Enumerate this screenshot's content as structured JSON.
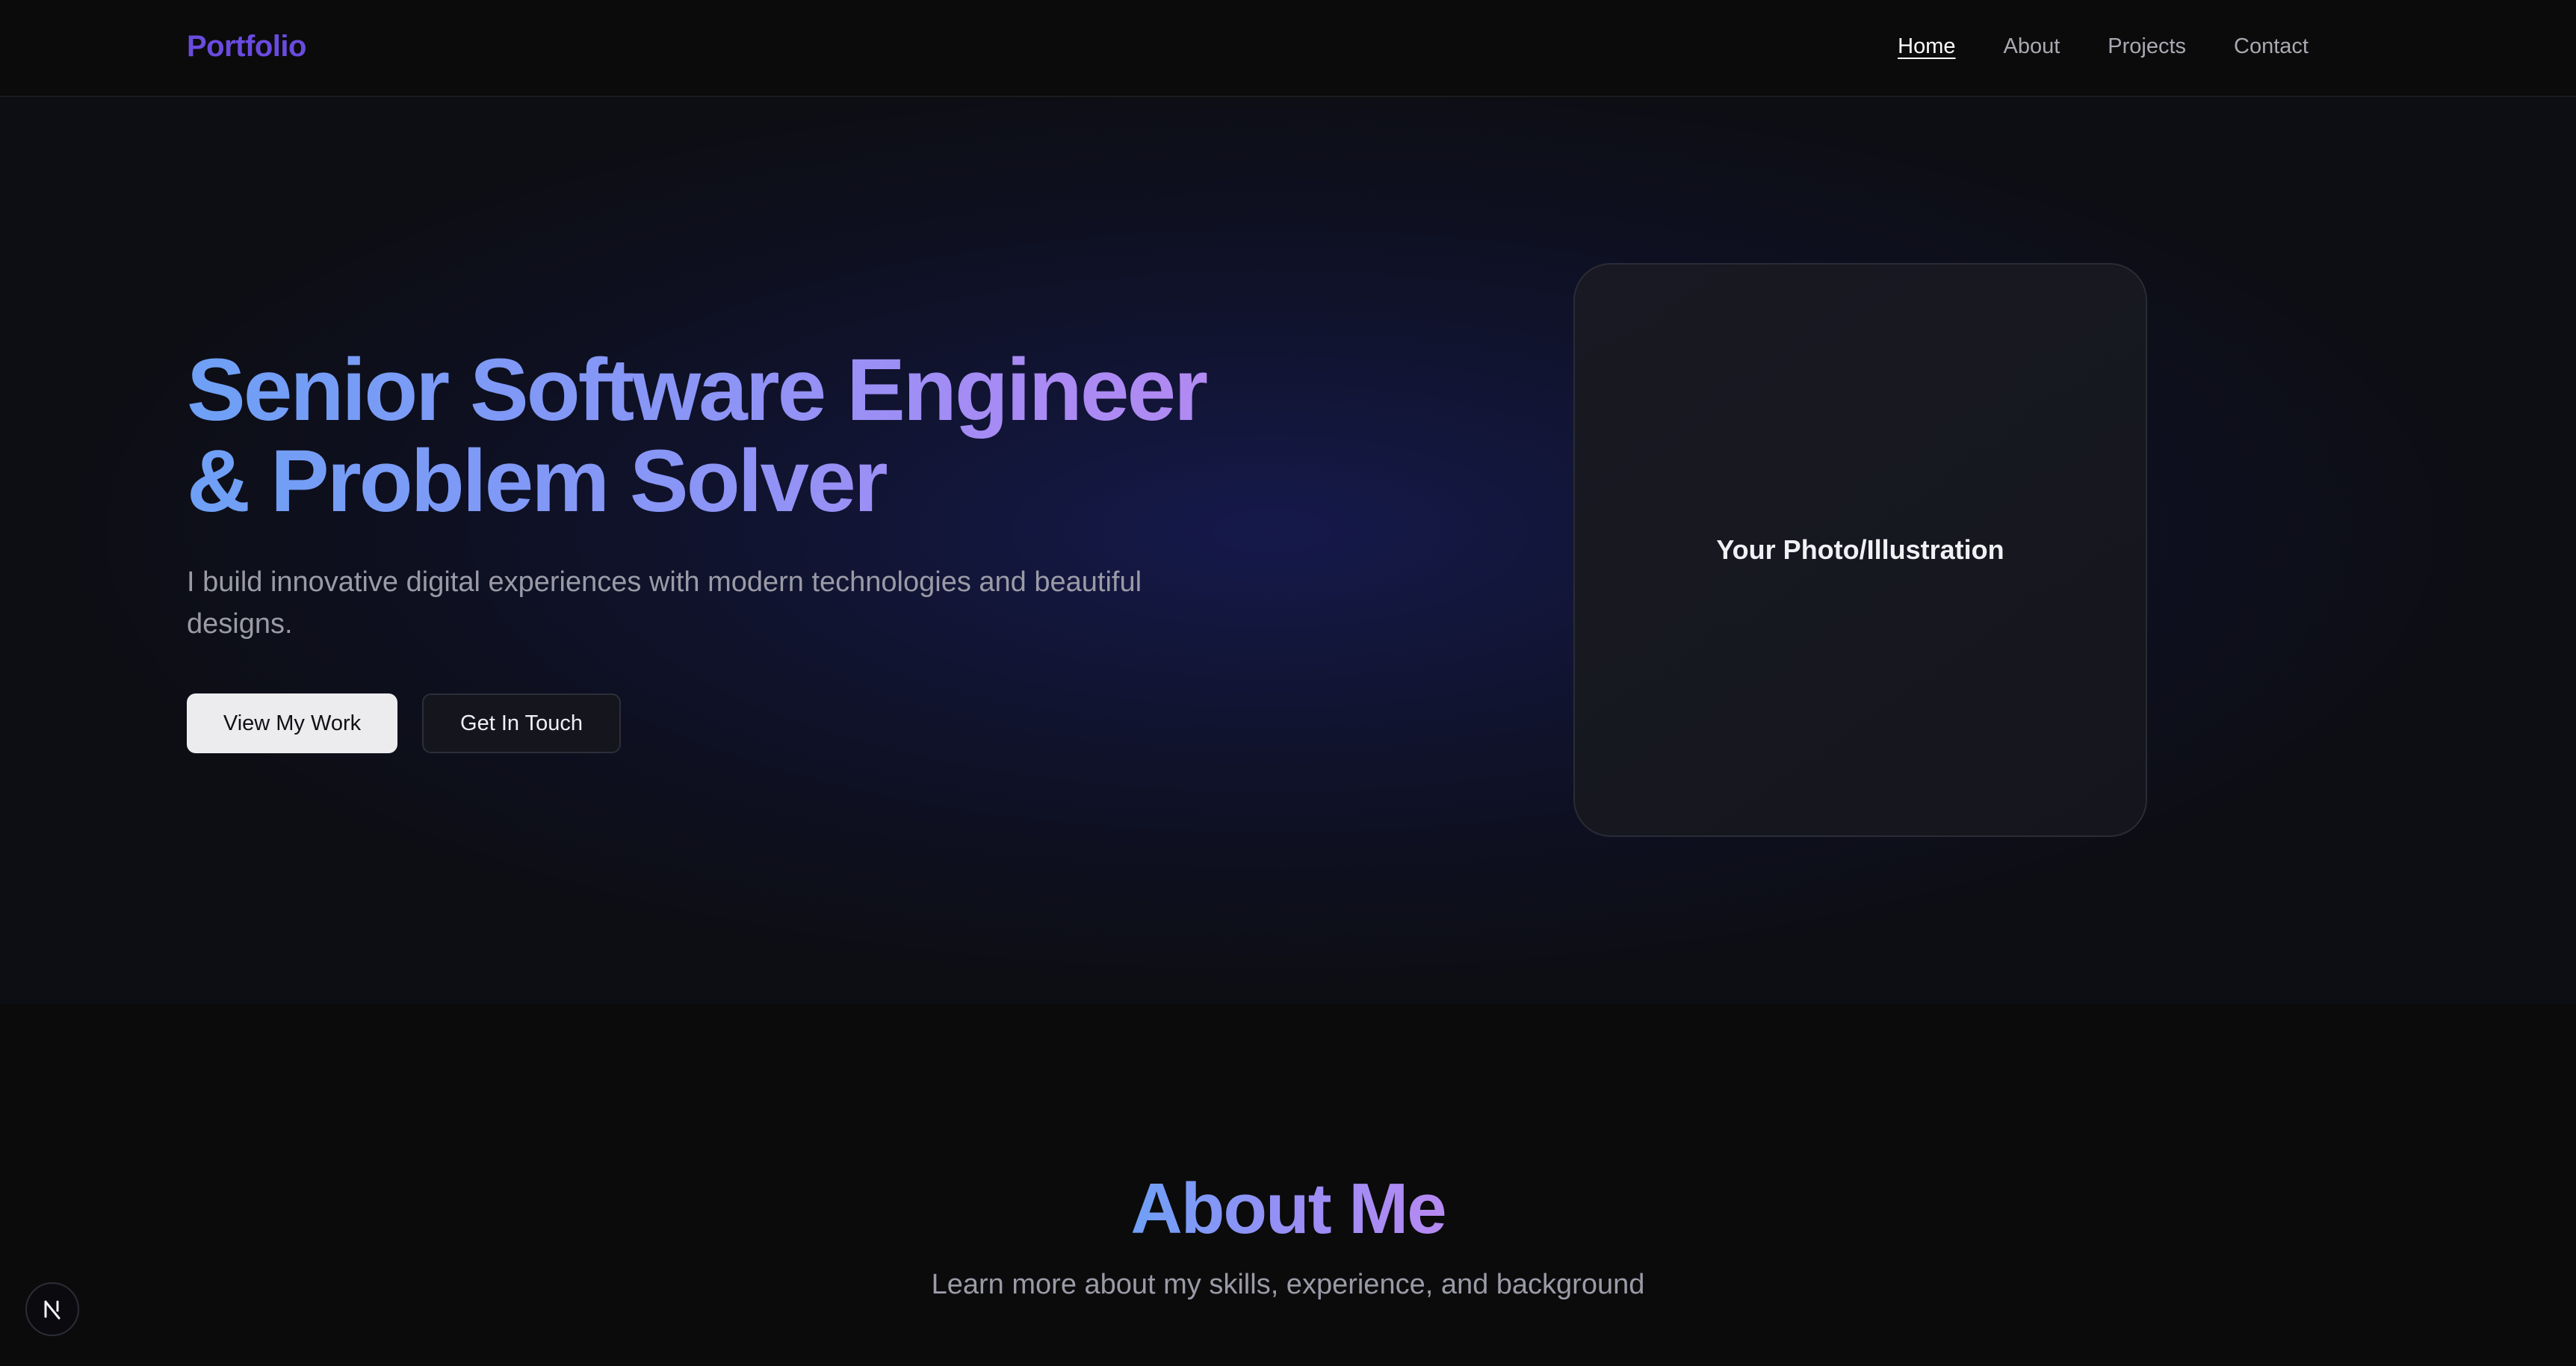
{
  "navbar": {
    "brand": "Portfolio",
    "links": [
      {
        "label": "Home",
        "active": true
      },
      {
        "label": "About",
        "active": false
      },
      {
        "label": "Projects",
        "active": false
      },
      {
        "label": "Contact",
        "active": false
      }
    ]
  },
  "hero": {
    "title_line1": "Senior Software Engineer",
    "title_line2": "& Problem Solver",
    "subtitle": "I build innovative digital experiences with modern technologies and beautiful designs.",
    "primary_button": "View My Work",
    "secondary_button": "Get In Touch",
    "photo_placeholder": "Your Photo/Illustration"
  },
  "about": {
    "title": "About Me",
    "subtitle": "Learn more about my skills, experience, and background"
  },
  "dev_badge": {
    "letter": "N",
    "icon": "nextjs-logo-icon"
  },
  "colors": {
    "brand": "#6a4bdf",
    "gradient_start": "#6ea0f6",
    "gradient_end": "#b68af1",
    "background": "#0b0b0c"
  }
}
